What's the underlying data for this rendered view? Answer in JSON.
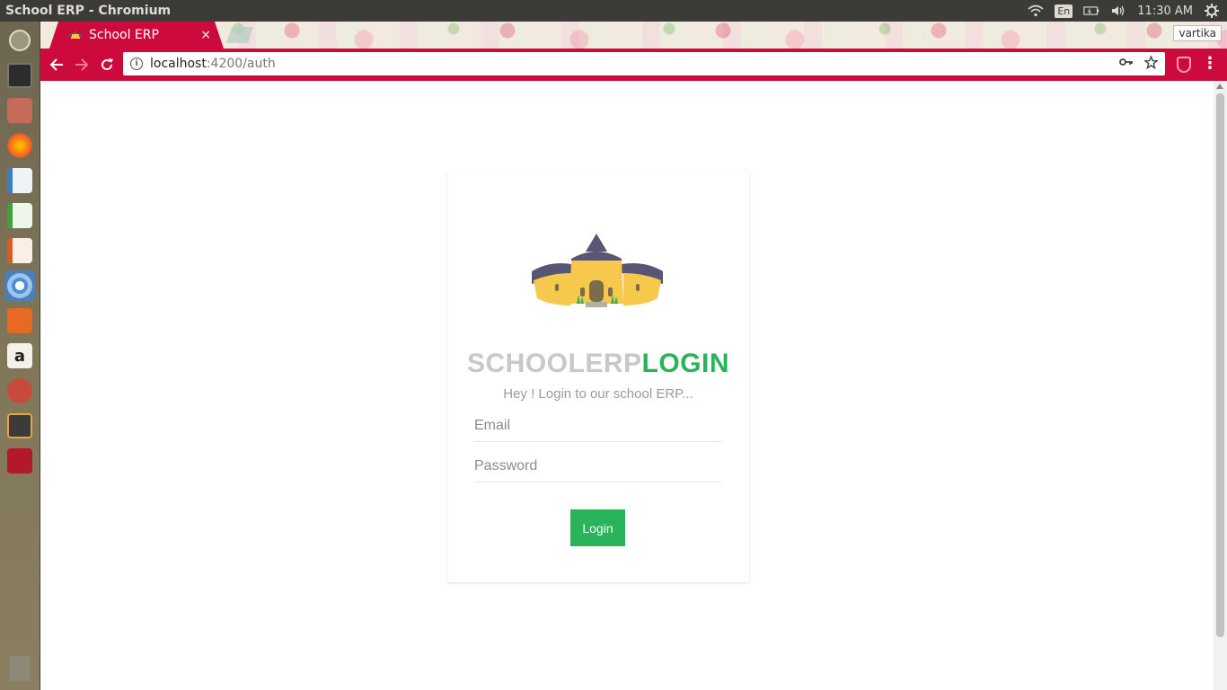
{
  "system": {
    "window_title": "School ERP - Chromium",
    "lang": "En",
    "time": "11:30 AM",
    "user": "vartika"
  },
  "browser": {
    "tab_title": "School ERP",
    "tab_close": "×",
    "url_host": "localhost",
    "url_path": ":4200/auth",
    "accent": "#cc0a3c"
  },
  "launcher": {
    "items": [
      "dash",
      "terminal",
      "files",
      "firefox",
      "writer",
      "calc",
      "impress",
      "chromium",
      "software",
      "amazon",
      "settings",
      "sublime",
      "ssh",
      "trash"
    ]
  },
  "login": {
    "heading_part1": "SCHOOLERP",
    "heading_part2": "LOGIN",
    "subtitle": "Hey ! Login to our school ERP...",
    "email_placeholder": "Email",
    "password_placeholder": "Password",
    "button_label": "Login",
    "accent": "#29b35a"
  }
}
